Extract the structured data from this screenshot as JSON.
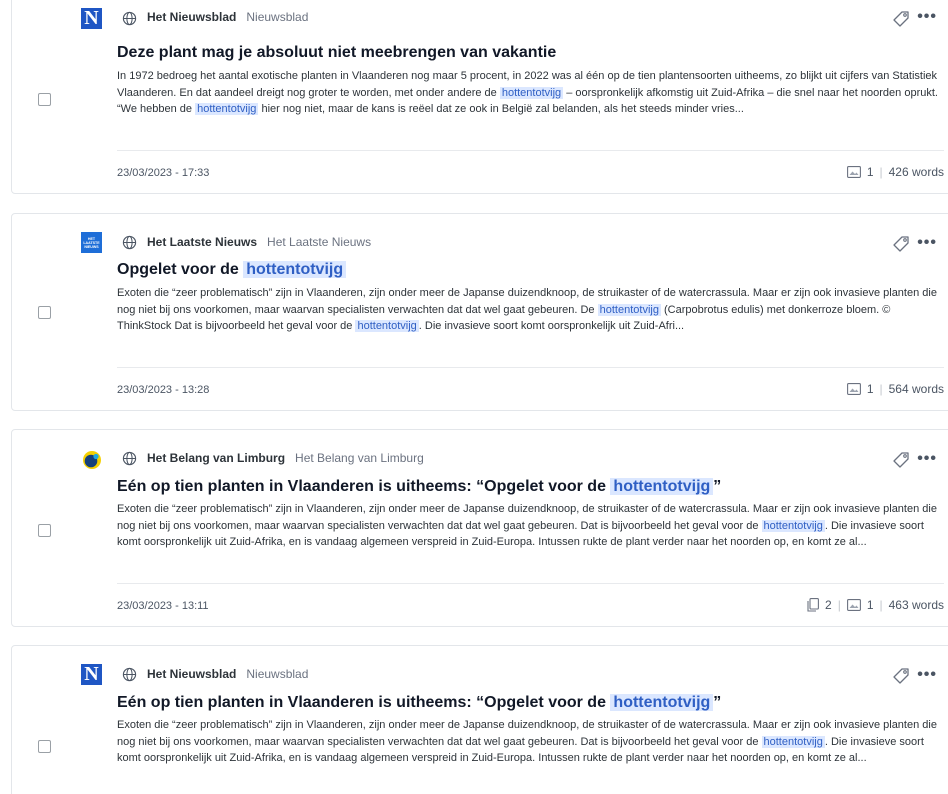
{
  "articles": [
    {
      "source_name": "Het Nieuwsblad",
      "source_sub": "Nieuwsblad",
      "logo": "nieuwsblad-logo",
      "logo_text": "N",
      "headline_pre": "Deze plant mag je absoluut niet meebrengen van vakantie",
      "headline_hl": "",
      "headline_post": "",
      "snippet": [
        {
          "t": "In 1972 bedroeg het aantal exotische planten in Vlaanderen nog maar 5 procent, in 2022 was al één op de tien plantensoorten uitheems, zo blijkt uit cijfers van Statistiek Vlaanderen. En dat aandeel dreigt nog groter te worden, met onder andere de "
        },
        {
          "t": "hottentotvijg",
          "hl": true
        },
        {
          "t": " – oorspronkelijk afkomstig uit Zuid-Afrika – die snel naar het noorden oprukt. “We hebben de "
        },
        {
          "t": "hottentotvijg",
          "hl": true
        },
        {
          "t": " hier nog niet, maar de kans is reëel dat ze ook in België zal belanden, als het steeds minder vries..."
        }
      ],
      "date": "23/03/2023 - 17:33",
      "images": "1",
      "pages": "",
      "words": "426 words"
    },
    {
      "source_name": "Het Laatste Nieuws",
      "source_sub": "Het Laatste Nieuws",
      "logo": "hln-logo",
      "logo_text": "HET LAATSTE NIEUWS",
      "headline_pre": "Opgelet voor de ",
      "headline_hl": "hottentotvijg",
      "headline_post": "",
      "snippet": [
        {
          "t": "Exoten die “zeer problematisch” zijn in Vlaanderen, zijn onder meer de Japanse duizendknoop, de struikaster of de watercrassula. Maar er zijn ook invasieve planten die nog niet bij ons voorkomen, maar waarvan specialisten verwachten dat dat wel gaat gebeuren. De "
        },
        {
          "t": "hottentotvijg",
          "hl": true
        },
        {
          "t": " (Carpobrotus edulis) met donkerroze bloem. © ThinkStock Dat is bijvoorbeeld het geval voor de "
        },
        {
          "t": "hottentotvijg",
          "hl": true
        },
        {
          "t": ". Die invasieve soort komt oorspronkelijk uit Zuid-Afri..."
        }
      ],
      "date": "23/03/2023 - 13:28",
      "images": "1",
      "pages": "",
      "words": "564 words"
    },
    {
      "source_name": "Het Belang van Limburg",
      "source_sub": "Het Belang van Limburg",
      "logo": "hbvl-logo",
      "logo_text": "",
      "headline_pre": "Eén op tien planten in Vlaanderen is uitheems: “Opgelet voor de ",
      "headline_hl": "hottentotvijg",
      "headline_post": "”",
      "snippet": [
        {
          "t": "Exoten die “zeer problematisch” zijn in Vlaanderen, zijn onder meer de Japanse duizendknoop, de struikaster of de watercrassula. Maar er zijn ook invasieve planten die nog niet bij ons voorkomen, maar waarvan specialisten verwachten dat dat wel gaat gebeuren. Dat is bijvoorbeeld het geval voor de "
        },
        {
          "t": "hottentotvijg",
          "hl": true
        },
        {
          "t": ". Die invasieve soort komt oorspronkelijk uit Zuid-Afrika, en is vandaag algemeen verspreid in Zuid-Europa. Intussen rukte de plant verder naar het noorden op, en komt ze al..."
        }
      ],
      "date": "23/03/2023 - 13:11",
      "images": "1",
      "pages": "2",
      "words": "463 words"
    },
    {
      "source_name": "Het Nieuwsblad",
      "source_sub": "Nieuwsblad",
      "logo": "nieuwsblad-logo",
      "logo_text": "N",
      "headline_pre": "Eén op tien planten in Vlaanderen is uitheems: “Opgelet voor de ",
      "headline_hl": "hottentotvijg",
      "headline_post": "”",
      "snippet": [
        {
          "t": "Exoten die “zeer problematisch” zijn in Vlaanderen, zijn onder meer de Japanse duizendknoop, de struikaster of de watercrassula. Maar er zijn ook invasieve planten die nog niet bij ons voorkomen, maar waarvan specialisten verwachten dat dat wel gaat gebeuren. Dat is bijvoorbeeld het geval voor de "
        },
        {
          "t": "hottentotvijg",
          "hl": true
        },
        {
          "t": ". Die invasieve soort komt oorspronkelijk uit Zuid-Afrika, en is vandaag algemeen verspreid in Zuid-Europa. Intussen rukte de plant verder naar het noorden op, en komt ze al..."
        }
      ],
      "date": "",
      "images": "",
      "pages": "",
      "words": ""
    }
  ],
  "icons": {
    "globe": "globe-icon",
    "tag": "tag-icon",
    "more": "more-options-icon",
    "image": "image-icon",
    "pages": "pages-icon",
    "more_glyph": "•••"
  },
  "colors": {
    "highlight_bg": "#dbe7ff",
    "highlight_text": "#2f5fc4",
    "nieuwsblad_blue": "#1f56c4",
    "hln_blue": "#1e6ed8",
    "hbvl_yellow": "#f5d000"
  }
}
